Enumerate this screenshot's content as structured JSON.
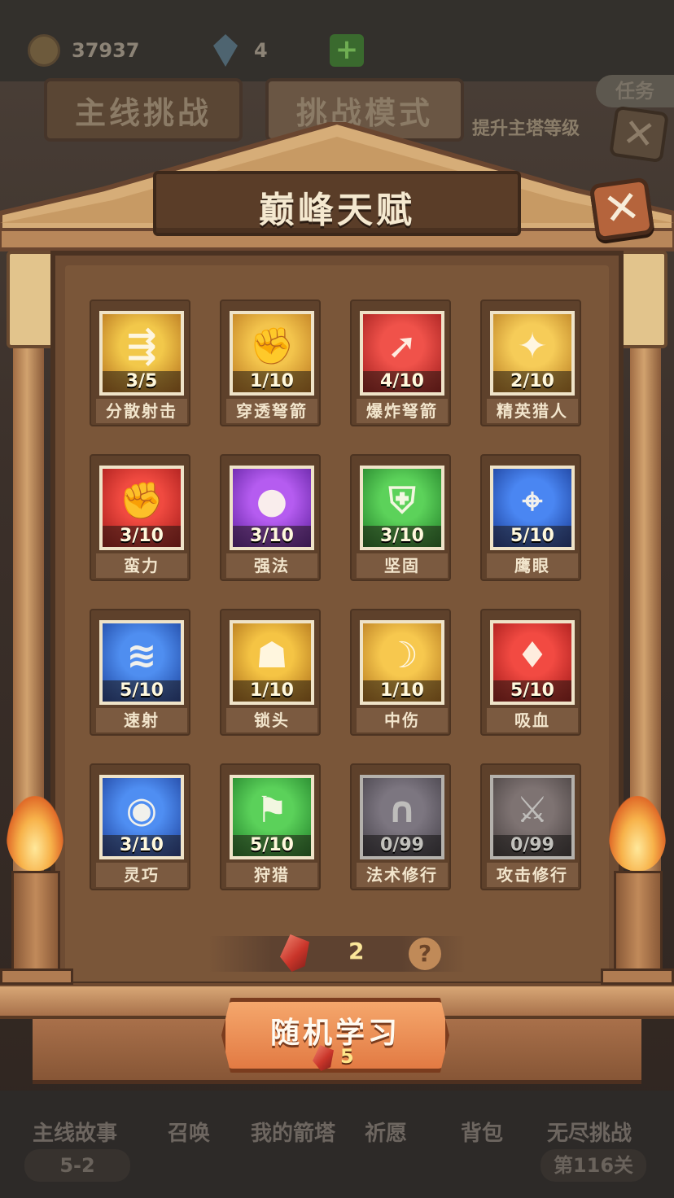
{
  "background": {
    "coins": "37937",
    "gems": "4",
    "tabs": [
      "主线挑战",
      "挑战模式"
    ],
    "task_label": "任务",
    "task_sub": "提升主塔等级",
    "bottom_nav": [
      {
        "label": "主线故事",
        "sub": "5-2"
      },
      {
        "label": "召唤"
      },
      {
        "label": "我的箭塔"
      },
      {
        "label": "祈愿"
      },
      {
        "label": "背包"
      },
      {
        "label": "无尽挑战",
        "sub": "第116关"
      }
    ]
  },
  "modal": {
    "title": "巅峰天赋",
    "close_glyph": "✕",
    "talents": [
      {
        "name": "分散射击",
        "level": "3/5",
        "colors": [
          "#f2c84a",
          "#b06a1a"
        ],
        "glyph": "⇶"
      },
      {
        "name": "穿透弩箭",
        "level": "1/10",
        "colors": [
          "#f3c44c",
          "#b8741e"
        ],
        "glyph": "✊"
      },
      {
        "name": "爆炸弩箭",
        "level": "4/10",
        "colors": [
          "#f0524a",
          "#9a1a1a"
        ],
        "glyph": "➚"
      },
      {
        "name": "精英猎人",
        "level": "2/10",
        "colors": [
          "#f6cc58",
          "#b5781f"
        ],
        "glyph": "✦"
      },
      {
        "name": "蛮力",
        "level": "3/10",
        "colors": [
          "#f04a40",
          "#a01818"
        ],
        "glyph": "✊"
      },
      {
        "name": "强法",
        "level": "3/10",
        "colors": [
          "#b55cf0",
          "#5a1d9a"
        ],
        "glyph": "●"
      },
      {
        "name": "坚固",
        "level": "3/10",
        "colors": [
          "#5cd25a",
          "#1f7a26"
        ],
        "glyph": "⛨"
      },
      {
        "name": "鹰眼",
        "level": "5/10",
        "colors": [
          "#4a86f2",
          "#17378f"
        ],
        "glyph": "⌖"
      },
      {
        "name": "速射",
        "level": "5/10",
        "colors": [
          "#4f8ef0",
          "#1a3f99"
        ],
        "glyph": "≋"
      },
      {
        "name": "锁头",
        "level": "1/10",
        "colors": [
          "#f5c444",
          "#a86a18"
        ],
        "glyph": "☗"
      },
      {
        "name": "中伤",
        "level": "1/10",
        "colors": [
          "#f7c84e",
          "#b0721c"
        ],
        "glyph": "☽"
      },
      {
        "name": "吸血",
        "level": "5/10",
        "colors": [
          "#f24a42",
          "#9b1616"
        ],
        "glyph": "♦"
      },
      {
        "name": "灵巧",
        "level": "3/10",
        "colors": [
          "#4f8ef2",
          "#1b3c96"
        ],
        "glyph": "◉"
      },
      {
        "name": "狩猎",
        "level": "5/10",
        "colors": [
          "#5bd15a",
          "#1e7b27"
        ],
        "glyph": "⚑"
      },
      {
        "name": "法术修行",
        "level": "0/99",
        "colors": [
          "#b08fc4",
          "#5f4a73"
        ],
        "glyph": "∩",
        "locked": true
      },
      {
        "name": "攻击修行",
        "level": "0/99",
        "colors": [
          "#c48a86",
          "#6e4a47"
        ],
        "glyph": "⚔",
        "locked": true
      }
    ],
    "crystal_count": "2",
    "help_glyph": "?",
    "learn_button": {
      "label": "随机学习",
      "cost": "5"
    }
  }
}
